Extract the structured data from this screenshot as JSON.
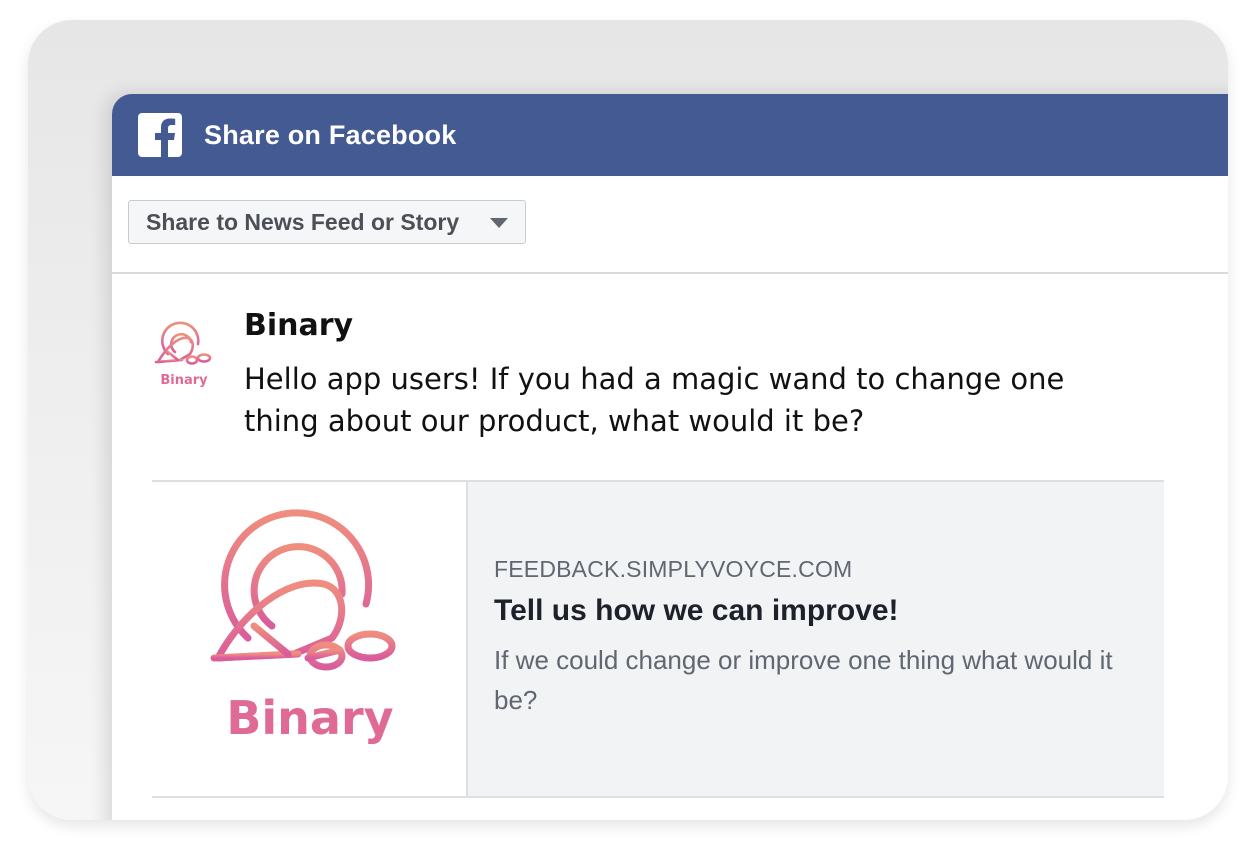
{
  "dialog": {
    "title": "Share on Facebook",
    "icon": "facebook-icon",
    "brand_color": "#435a93"
  },
  "toolbar": {
    "share_target_selected": "Share to News Feed or Story"
  },
  "post": {
    "author": "Binary",
    "message": "Hello app users! If you had a magic wand to change one thing about our product, what would it be?",
    "avatar_logo_text": "Binary",
    "avatar_icon": "binary-bird-logo"
  },
  "link_card": {
    "image_logo_text": "Binary",
    "domain": "FEEDBACK.SIMPLYVOYCE.COM",
    "title": "Tell us how we can improve!",
    "description": "If we could change or improve one thing what would it be?",
    "logo_color": "#e06a96"
  }
}
